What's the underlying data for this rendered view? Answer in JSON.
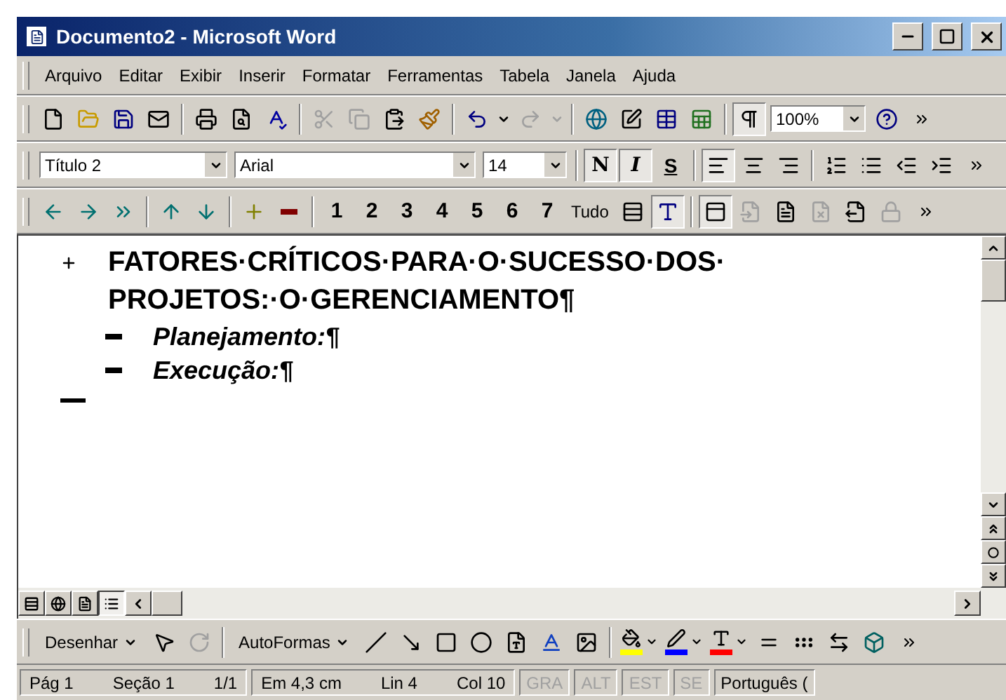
{
  "window": {
    "title": "Documento2 - Microsoft Word"
  },
  "menu": [
    "Arquivo",
    "Editar",
    "Exibir",
    "Inserir",
    "Formatar",
    "Ferramentas",
    "Tabela",
    "Janela",
    "Ajuda"
  ],
  "standard_toolbar": [
    {
      "kind": "button",
      "disabled": false,
      "pressed": false
    },
    {
      "kind": "button",
      "disabled": false,
      "pressed": false
    },
    {
      "kind": "button",
      "disabled": false,
      "pressed": false
    },
    {
      "kind": "button",
      "disabled": false,
      "pressed": false
    },
    {
      "kind": "separator"
    },
    {
      "kind": "button",
      "disabled": false,
      "pressed": false
    },
    {
      "kind": "button",
      "disabled": false,
      "pressed": false
    },
    {
      "kind": "button",
      "disabled": false,
      "pressed": false
    },
    {
      "kind": "separator"
    },
    {
      "kind": "button",
      "disabled": true,
      "pressed": false
    },
    {
      "kind": "button",
      "disabled": true,
      "pressed": false
    },
    {
      "kind": "button",
      "disabled": false,
      "pressed": false
    },
    {
      "kind": "button",
      "disabled": false,
      "pressed": false
    },
    {
      "kind": "separator"
    },
    {
      "kind": "button",
      "disabled": false,
      "pressed": false
    },
    {
      "kind": "caret",
      "disabled": false
    },
    {
      "kind": "button",
      "disabled": true,
      "pressed": false
    },
    {
      "kind": "caret",
      "disabled": true
    },
    {
      "kind": "separator"
    },
    {
      "kind": "button",
      "disabled": false,
      "pressed": false
    },
    {
      "kind": "button",
      "disabled": false,
      "pressed": false
    },
    {
      "kind": "button",
      "disabled": false,
      "pressed": false
    },
    {
      "kind": "button",
      "disabled": false,
      "pressed": false
    },
    {
      "kind": "separator"
    },
    {
      "kind": "button",
      "disabled": false,
      "pressed": true
    },
    {
      "kind": "combo",
      "value": "100%"
    },
    {
      "kind": "button",
      "disabled": false,
      "pressed": false
    },
    {
      "kind": "more"
    }
  ],
  "formatting_toolbar": [
    {
      "kind": "combo",
      "value": "Título 2"
    },
    {
      "kind": "combo",
      "value": "Arial"
    },
    {
      "kind": "combo",
      "value": "14"
    },
    {
      "kind": "separator"
    },
    {
      "kind": "letter",
      "label": "N",
      "pressed": true
    },
    {
      "kind": "letter",
      "label": "I",
      "pressed": true
    },
    {
      "kind": "letter",
      "label": "S",
      "pressed": false
    },
    {
      "kind": "separator"
    },
    {
      "kind": "button",
      "disabled": false,
      "pressed": true
    },
    {
      "kind": "button",
      "disabled": false,
      "pressed": false
    },
    {
      "kind": "button",
      "disabled": false,
      "pressed": false
    },
    {
      "kind": "separator"
    },
    {
      "kind": "button",
      "disabled": false,
      "pressed": false
    },
    {
      "kind": "button",
      "disabled": false,
      "pressed": false
    },
    {
      "kind": "button",
      "disabled": false,
      "pressed": false
    },
    {
      "kind": "button",
      "disabled": false,
      "pressed": false
    },
    {
      "kind": "more"
    }
  ],
  "outlining_toolbar": [
    {
      "kind": "button",
      "disabled": false,
      "pressed": false
    },
    {
      "kind": "button",
      "disabled": false,
      "pressed": false
    },
    {
      "kind": "button",
      "disabled": false,
      "pressed": false
    },
    {
      "kind": "separator"
    },
    {
      "kind": "button",
      "disabled": false,
      "pressed": false
    },
    {
      "kind": "button",
      "disabled": false,
      "pressed": false
    },
    {
      "kind": "separator"
    },
    {
      "kind": "button",
      "disabled": false,
      "pressed": false
    },
    {
      "kind": "button",
      "disabled": false,
      "pressed": false
    },
    {
      "kind": "separator"
    },
    {
      "kind": "level",
      "label": "1"
    },
    {
      "kind": "level",
      "label": "2"
    },
    {
      "kind": "level",
      "label": "3"
    },
    {
      "kind": "level",
      "label": "4"
    },
    {
      "kind": "level",
      "label": "5"
    },
    {
      "kind": "level",
      "label": "6"
    },
    {
      "kind": "level",
      "label": "7"
    },
    {
      "kind": "text",
      "label": "Tudo"
    },
    {
      "kind": "button",
      "disabled": false,
      "pressed": false
    },
    {
      "kind": "button",
      "disabled": false,
      "pressed": true
    },
    {
      "kind": "separator"
    },
    {
      "kind": "button",
      "disabled": false,
      "pressed": true
    },
    {
      "kind": "button",
      "disabled": true,
      "pressed": false
    },
    {
      "kind": "button",
      "disabled": false,
      "pressed": false
    },
    {
      "kind": "button",
      "disabled": true,
      "pressed": false
    },
    {
      "kind": "button",
      "disabled": false,
      "pressed": false
    },
    {
      "kind": "button",
      "disabled": true,
      "pressed": false
    },
    {
      "kind": "more"
    }
  ],
  "document": {
    "items": [
      {
        "kind": "heading",
        "lines": [
          "FATORES·CRÍTICOS·PARA·O·SUCESSO·DOS·",
          "PROJETOS:·O·GERENCIAMENTO¶"
        ],
        "children": [
          {
            "kind": "body",
            "lines": [
              "Planejamento:¶"
            ]
          },
          {
            "kind": "body",
            "lines": [
              "Execução:¶"
            ]
          }
        ]
      }
    ]
  },
  "view_buttons": [
    {
      "selected": false
    },
    {
      "selected": false
    },
    {
      "selected": false
    },
    {
      "selected": true
    }
  ],
  "drawing_toolbar": [
    {
      "kind": "menu",
      "label": "Desenhar"
    },
    {
      "kind": "button",
      "disabled": false
    },
    {
      "kind": "button",
      "disabled": true
    },
    {
      "kind": "separator"
    },
    {
      "kind": "menu",
      "label": "AutoFormas"
    },
    {
      "kind": "button",
      "disabled": false
    },
    {
      "kind": "button",
      "disabled": false
    },
    {
      "kind": "button",
      "disabled": false
    },
    {
      "kind": "button",
      "disabled": false
    },
    {
      "kind": "button",
      "disabled": false
    },
    {
      "kind": "button",
      "disabled": false
    },
    {
      "kind": "button",
      "disabled": false
    },
    {
      "kind": "separator"
    },
    {
      "kind": "color",
      "color": "#ffff00"
    },
    {
      "kind": "color",
      "color": "#0000ff"
    },
    {
      "kind": "color",
      "color": "#ff0000"
    },
    {
      "kind": "button",
      "disabled": false
    },
    {
      "kind": "button",
      "disabled": false
    },
    {
      "kind": "button",
      "disabled": false
    },
    {
      "kind": "button",
      "disabled": false
    },
    {
      "kind": "more"
    }
  ],
  "status_bar": [
    {
      "kind": "group",
      "fields": [
        {
          "text": "Pág 1"
        },
        {
          "text": "Seção 1"
        },
        {
          "text": "1/1"
        }
      ]
    },
    {
      "kind": "group",
      "fields": [
        {
          "text": "Em 4,3 cm"
        },
        {
          "text": "Lin 4"
        },
        {
          "text": "Col 10"
        }
      ]
    },
    {
      "kind": "flag",
      "text": "GRA",
      "disabled": true
    },
    {
      "kind": "flag",
      "text": "ALT",
      "disabled": true
    },
    {
      "kind": "flag",
      "text": "EST",
      "disabled": true
    },
    {
      "kind": "flag",
      "text": "SE",
      "disabled": true
    },
    {
      "kind": "flag",
      "text": "Português (",
      "disabled": false
    }
  ]
}
